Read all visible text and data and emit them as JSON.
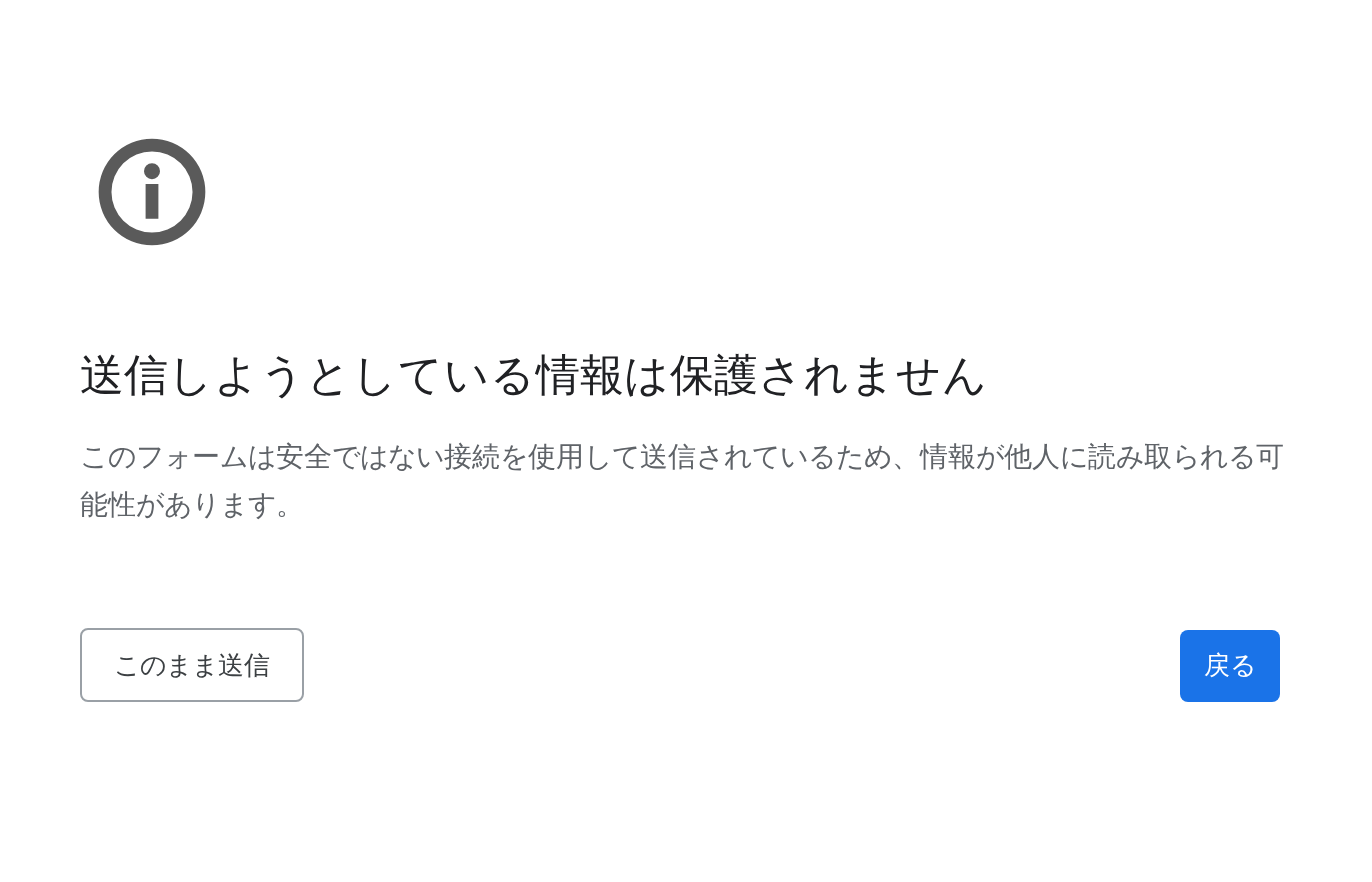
{
  "title": "送信しようとしている情報は保護されません",
  "message": "このフォームは安全ではない接続を使用して送信されているため、情報が他人に読み取られる可能性があります。",
  "buttons": [
    {
      "label": "このまま送信",
      "kind": "secondary"
    },
    {
      "label": "戻る",
      "kind": "primary"
    }
  ]
}
